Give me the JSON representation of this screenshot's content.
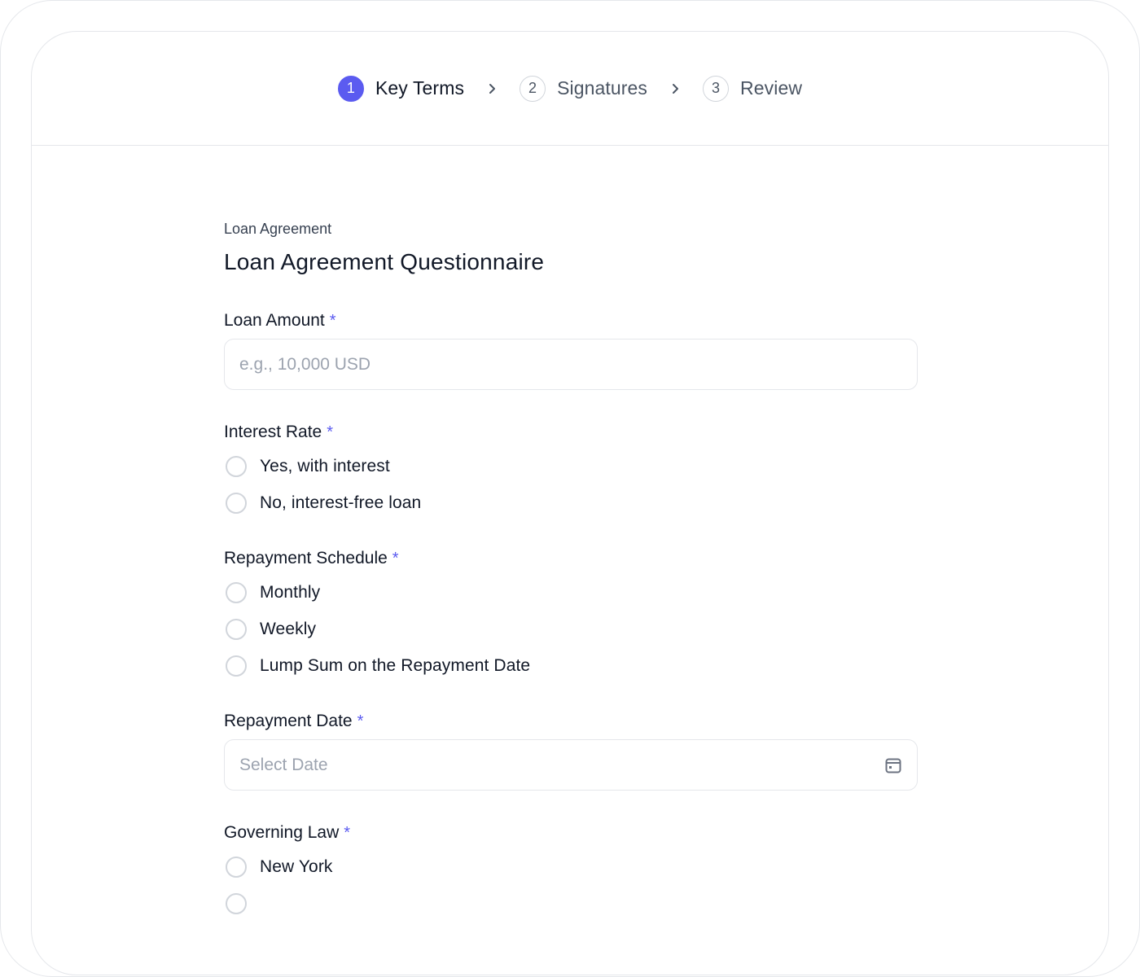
{
  "stepper": {
    "steps": [
      {
        "number": "1",
        "label": "Key Terms",
        "active": true
      },
      {
        "number": "2",
        "label": "Signatures",
        "active": false
      },
      {
        "number": "3",
        "label": "Review",
        "active": false
      }
    ],
    "separator_icon": "chevron-right-icon"
  },
  "form": {
    "eyebrow": "Loan Agreement",
    "title": "Loan Agreement Questionnaire",
    "required_marker": "*",
    "loan_amount": {
      "label": "Loan Amount",
      "placeholder": "e.g., 10,000 USD"
    },
    "interest_rate": {
      "label": "Interest Rate",
      "options": [
        "Yes, with interest",
        "No, interest-free loan"
      ]
    },
    "repayment_schedule": {
      "label": "Repayment Schedule",
      "options": [
        "Monthly",
        "Weekly",
        "Lump Sum on the Repayment Date"
      ]
    },
    "repayment_date": {
      "label": "Repayment Date",
      "placeholder": "Select Date",
      "icon": "calendar-icon"
    },
    "governing_law": {
      "label": "Governing Law",
      "options": [
        "New York"
      ]
    }
  },
  "colors": {
    "accent": "#5b5bf0",
    "border": "#e5e7eb",
    "placeholder": "#9ca3af"
  }
}
